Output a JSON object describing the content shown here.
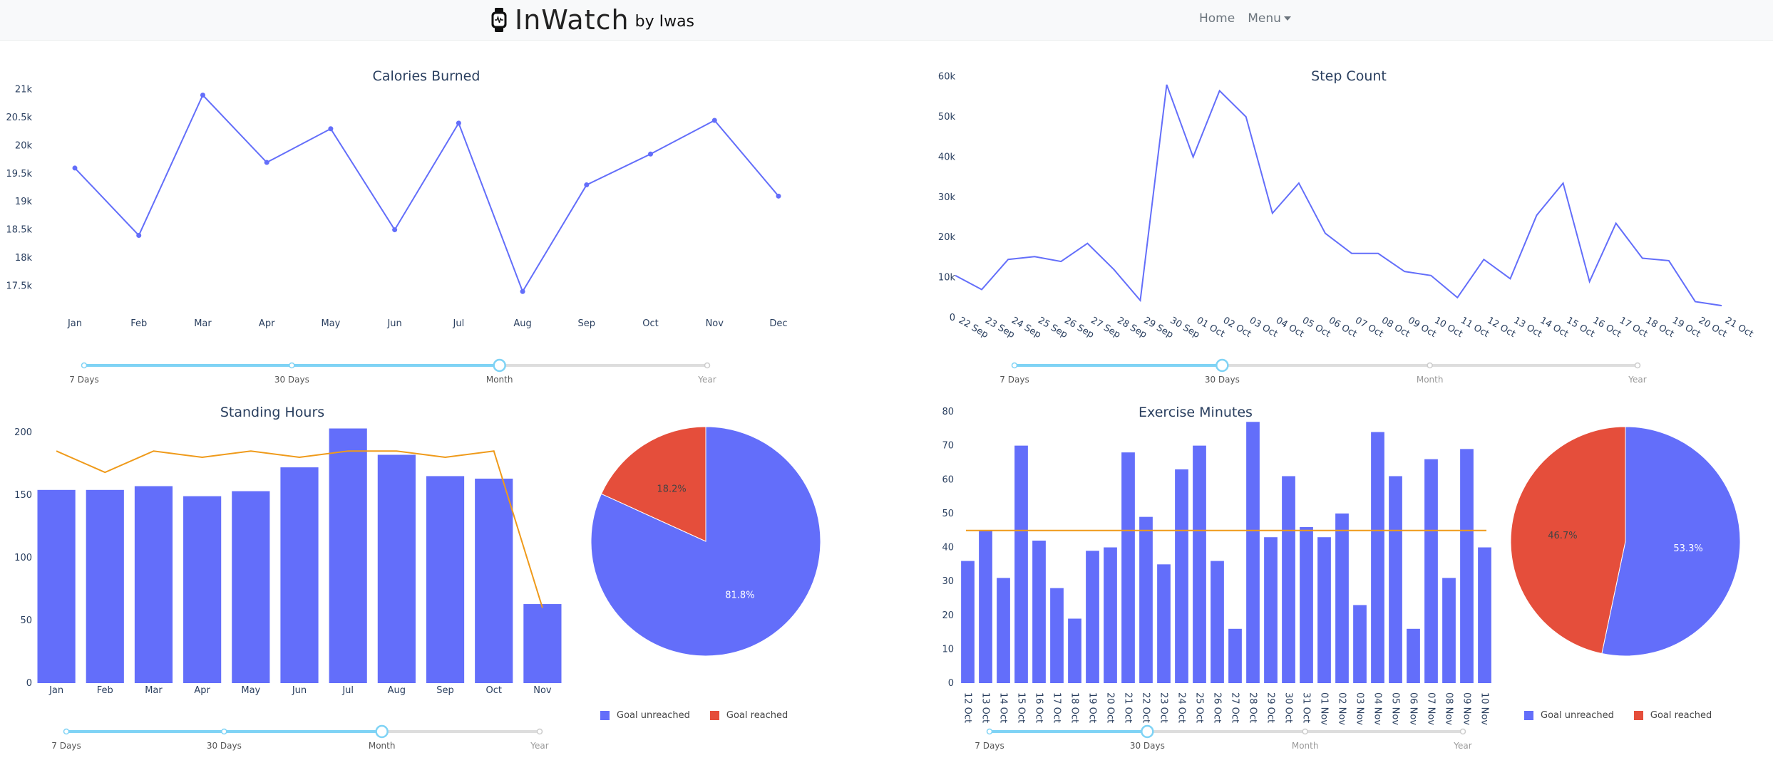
{
  "header": {
    "brand_name": "InWatch",
    "brand_by": "by Iwas",
    "nav": {
      "home": "Home",
      "menu": "Menu"
    }
  },
  "colors": {
    "series": "#636efa",
    "accent": "#ef9a1a",
    "pie_reached": "#e54e3b",
    "slider_active": "#7fd3f5",
    "slider_inactive": "#dddddd"
  },
  "icons": {
    "brand": "smartwatch-icon",
    "menu_caret": "caret-down-icon"
  },
  "sliders": {
    "calories": {
      "labels": [
        "7 Days",
        "30 Days",
        "Month",
        "Year"
      ],
      "selected": 2
    },
    "steps": {
      "labels": [
        "7 Days",
        "30 Days",
        "Month",
        "Year"
      ],
      "selected": 1
    },
    "standing": {
      "labels": [
        "7 Days",
        "30 Days",
        "Month",
        "Year"
      ],
      "selected": 2
    },
    "exercise": {
      "labels": [
        "7 Days",
        "30 Days",
        "Month",
        "Year"
      ],
      "selected": 1
    }
  },
  "legends": {
    "standing": [
      "Goal unreached",
      "Goal reached"
    ],
    "exercise": [
      "Goal unreached",
      "Goal reached"
    ]
  },
  "chart_data": [
    {
      "id": "calories",
      "type": "line",
      "title": "Calories Burned",
      "categories": [
        "Jan",
        "Feb",
        "Mar",
        "Apr",
        "May",
        "Jun",
        "Jul",
        "Aug",
        "Sep",
        "Oct",
        "Nov",
        "Dec"
      ],
      "values": [
        19600,
        18400,
        20900,
        19700,
        20300,
        18500,
        20400,
        17400,
        19300,
        19850,
        20450,
        19100
      ],
      "ylim": [
        17200,
        21300
      ],
      "yticks": [
        17500,
        18000,
        18500,
        19000,
        19500,
        20000,
        20500,
        21000
      ],
      "yticklabels": [
        "17.5k",
        "18k",
        "18.5k",
        "19k",
        "19.5k",
        "20k",
        "20.5k",
        "21k"
      ],
      "markers": true
    },
    {
      "id": "steps",
      "type": "line",
      "title": "Step Count",
      "categories": [
        "22 Sep",
        "23 Sep",
        "24 Sep",
        "25 Sep",
        "26 Sep",
        "27 Sep",
        "28 Sep",
        "29 Sep",
        "30 Sep",
        "01 Oct",
        "02 Oct",
        "03 Oct",
        "04 Oct",
        "05 Oct",
        "06 Oct",
        "07 Oct",
        "08 Oct",
        "09 Oct",
        "10 Oct",
        "11 Oct",
        "12 Oct",
        "13 Oct",
        "14 Oct",
        "15 Oct",
        "16 Oct",
        "17 Oct",
        "18 Oct",
        "19 Oct",
        "20 Oct",
        "21 Oct"
      ],
      "values": [
        10500,
        7000,
        14500,
        15200,
        14000,
        18500,
        12000,
        4300,
        58000,
        40000,
        56500,
        50000,
        26000,
        33500,
        21000,
        16000,
        16000,
        11500,
        10500,
        5000,
        14500,
        9700,
        25500,
        33500,
        9000,
        23500,
        14800,
        14200,
        4000,
        3000
      ],
      "ylim": [
        0,
        61000
      ],
      "yticks": [
        0,
        10000,
        20000,
        30000,
        40000,
        50000,
        60000
      ],
      "yticklabels": [
        "0",
        "10k",
        "20k",
        "30k",
        "40k",
        "50k",
        "60k"
      ],
      "markers": false
    },
    {
      "id": "standing",
      "type": "bar",
      "title": "Standing Hours",
      "categories": [
        "Jan",
        "Feb",
        "Mar",
        "Apr",
        "May",
        "Jun",
        "Jul",
        "Aug",
        "Sep",
        "Oct",
        "Nov"
      ],
      "values": [
        154,
        154,
        157,
        149,
        153,
        172,
        203,
        182,
        165,
        163,
        63
      ],
      "goal_line": [
        185,
        168,
        185,
        180,
        185,
        180,
        185,
        185,
        180,
        185,
        60
      ],
      "ylim": [
        0,
        205
      ],
      "yticks": [
        0,
        50,
        100,
        150,
        200
      ],
      "yticklabels": [
        "0",
        "50",
        "100",
        "150",
        "200"
      ]
    },
    {
      "id": "standing_pie",
      "type": "pie",
      "labels": [
        "Goal unreached",
        "Goal reached"
      ],
      "values": [
        81.8,
        18.2
      ],
      "text": [
        "81.8%",
        "18.2%"
      ]
    },
    {
      "id": "exercise",
      "type": "bar",
      "title": "Exercise Minutes",
      "categories": [
        "12 Oct",
        "13 Oct",
        "14 Oct",
        "15 Oct",
        "16 Oct",
        "17 Oct",
        "18 Oct",
        "19 Oct",
        "20 Oct",
        "21 Oct",
        "22 Oct",
        "23 Oct",
        "24 Oct",
        "25 Oct",
        "26 Oct",
        "27 Oct",
        "28 Oct",
        "29 Oct",
        "30 Oct",
        "31 Oct",
        "01 Nov",
        "02 Nov",
        "03 Nov",
        "04 Nov",
        "05 Nov",
        "06 Nov",
        "07 Nov",
        "08 Nov",
        "09 Nov",
        "10 Nov"
      ],
      "values": [
        36,
        45,
        31,
        70,
        42,
        28,
        19,
        39,
        40,
        68,
        49,
        35,
        63,
        70,
        36,
        16,
        77,
        43,
        61,
        46,
        43,
        50,
        23,
        74,
        61,
        16,
        66,
        31,
        69,
        40
      ],
      "goal": 45,
      "ylim": [
        0,
        80
      ],
      "yticks": [
        0,
        10,
        20,
        30,
        40,
        50,
        60,
        70,
        80
      ],
      "yticklabels": [
        "0",
        "10",
        "20",
        "30",
        "40",
        "50",
        "60",
        "70",
        "80"
      ]
    },
    {
      "id": "exercise_pie",
      "type": "pie",
      "labels": [
        "Goal unreached",
        "Goal reached"
      ],
      "values": [
        53.3,
        46.7
      ],
      "text": [
        "53.3%",
        "46.7%"
      ]
    }
  ]
}
